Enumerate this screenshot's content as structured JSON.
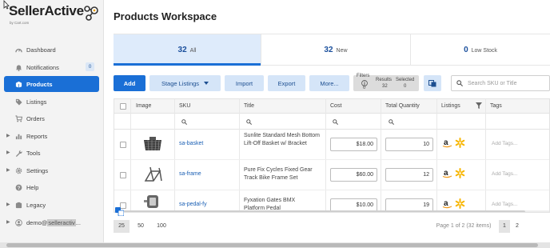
{
  "app": {
    "logo_text": "SellerActive",
    "logo_sub": "by Cart.com"
  },
  "sidebar": {
    "items": [
      {
        "label": "Dashboard",
        "icon": "dashboard-icon"
      },
      {
        "label": "Notifications",
        "icon": "bell-icon",
        "badge": "0"
      },
      {
        "label": "Products",
        "icon": "box-icon",
        "active": true
      },
      {
        "label": "Listings",
        "icon": "tag-icon"
      },
      {
        "label": "Orders",
        "icon": "cart-icon"
      },
      {
        "label": "Reports",
        "icon": "chart-icon"
      },
      {
        "label": "Tools",
        "icon": "wrench-icon"
      },
      {
        "label": "Settings",
        "icon": "gear-icon"
      },
      {
        "label": "Help",
        "icon": "help-icon"
      },
      {
        "label": "Legacy",
        "icon": "legacy-icon"
      },
      {
        "label_prefix": "demo@",
        "label_masked": "selleractiv",
        "label_suffix": "...",
        "icon": "user-icon"
      }
    ]
  },
  "main": {
    "title": "Products Workspace",
    "tabs": [
      {
        "count": "32",
        "label": "All",
        "active": true
      },
      {
        "count": "32",
        "label": "New"
      },
      {
        "count": "0",
        "label": "Low Stock"
      }
    ],
    "toolbar": {
      "add": "Add",
      "stage_listings": "Stage Listings",
      "import": "Import",
      "export": "Export",
      "more": "More...",
      "filters_label": "Filters",
      "filters_count": "0",
      "results_label": "Results",
      "results_count": "32",
      "selected_label": "Selected",
      "selected_count": "0",
      "search_placeholder": "Search SKU or Title"
    },
    "grid": {
      "columns": [
        "Image",
        "SKU",
        "Title",
        "Cost",
        "Total Quantity",
        "Listings",
        "Tags"
      ],
      "rows": [
        {
          "sku": "sa-basket",
          "title": "Sunlite Standard Mesh Bottom Lift-Off Basket w/ Bracket",
          "cost": "$18.00",
          "qty": "10",
          "tags": "Add Tags..."
        },
        {
          "sku": "sa-frame",
          "title": "Pure Fix Cycles Fixed Gear Track Bike Frame Set",
          "cost": "$60.00",
          "qty": "12",
          "tags": "Add Tags..."
        },
        {
          "sku": "sa-pedal-fy",
          "title": "Fyxation Gates BMX Platform Pedal",
          "cost": "$10.00",
          "qty": "19",
          "tags": "Add Tags..."
        }
      ]
    },
    "pager": {
      "sizes": [
        "25",
        "50",
        "100"
      ],
      "selected_size": "25",
      "info": "Page 1 of 2 (32 items)",
      "pages": [
        "1",
        "2"
      ],
      "current_page": "1"
    }
  },
  "colors": {
    "accent": "#1a6fd6",
    "light_accent": "#d5e5f8",
    "amazon": "#222222",
    "walmart": "#f7b500"
  }
}
